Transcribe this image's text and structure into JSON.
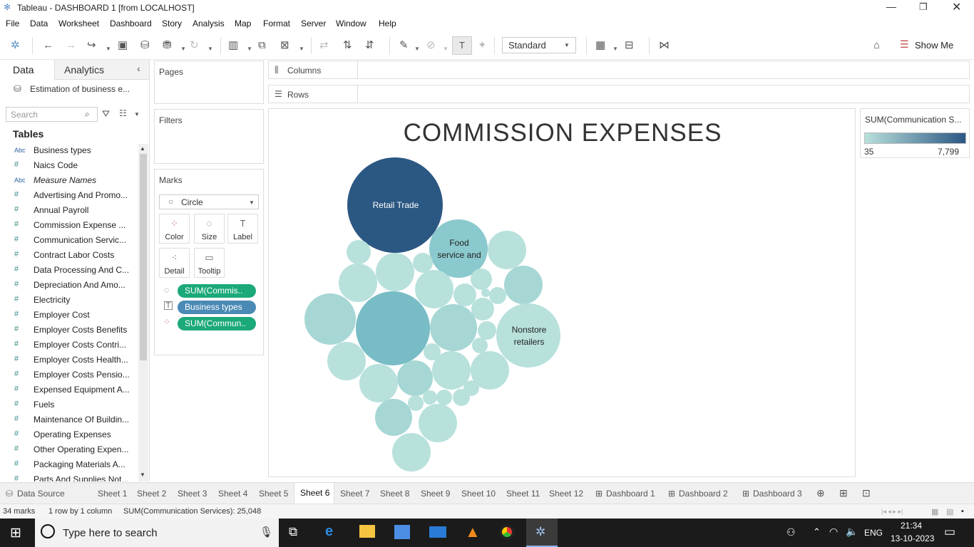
{
  "window": {
    "title": "Tableau - DASHBOARD 1 [from LOCALHOST]"
  },
  "menu": [
    "File",
    "Data",
    "Worksheet",
    "Dashboard",
    "Story",
    "Analysis",
    "Map",
    "Format",
    "Server",
    "Window",
    "Help"
  ],
  "toolbar": {
    "fit": "Standard",
    "show_me": "Show Me"
  },
  "sidepanel": {
    "tab_data": "Data",
    "tab_analytics": "Analytics",
    "datasource": "Estimation of business e...",
    "search_placeholder": "Search",
    "tables_heading": "Tables",
    "fields": [
      {
        "icon": "Abc",
        "name": "Business types"
      },
      {
        "icon": "#",
        "name": "Naics Code"
      },
      {
        "icon": "Abc",
        "name": "Measure Names"
      },
      {
        "icon": "#",
        "name": "Advertising And Promo..."
      },
      {
        "icon": "#",
        "name": "Annual Payroll"
      },
      {
        "icon": "#",
        "name": "Commission Expense ..."
      },
      {
        "icon": "#",
        "name": "Communication Servic..."
      },
      {
        "icon": "#",
        "name": "Contract Labor Costs"
      },
      {
        "icon": "#",
        "name": "Data Processing And C..."
      },
      {
        "icon": "#",
        "name": "Depreciation And Amo..."
      },
      {
        "icon": "#",
        "name": "Electricity"
      },
      {
        "icon": "#",
        "name": "Employer Cost"
      },
      {
        "icon": "#",
        "name": "Employer Costs Benefits"
      },
      {
        "icon": "#",
        "name": "Employer Costs Contri..."
      },
      {
        "icon": "#",
        "name": "Employer Costs Health..."
      },
      {
        "icon": "#",
        "name": "Employer Costs Pensio..."
      },
      {
        "icon": "#",
        "name": "Expensed Equipment A..."
      },
      {
        "icon": "#",
        "name": "Fuels"
      },
      {
        "icon": "#",
        "name": "Maintenance Of Buildin..."
      },
      {
        "icon": "#",
        "name": "Operating Expenses"
      },
      {
        "icon": "#",
        "name": "Other Operating Expen..."
      },
      {
        "icon": "#",
        "name": "Packaging Materials A..."
      },
      {
        "icon": "#",
        "name": "Parts And Supplies Not..."
      }
    ]
  },
  "cards": {
    "pages": "Pages",
    "filters": "Filters",
    "marks": "Marks",
    "mark_type": "Circle",
    "mark_buttons": [
      "Color",
      "Size",
      "Label",
      "Detail",
      "Tooltip"
    ],
    "pills": [
      "SUM(Commis..",
      "Business types",
      "SUM(Commun.."
    ]
  },
  "shelves": {
    "columns": "Columns",
    "rows": "Rows"
  },
  "viz": {
    "title": "COMMISSION EXPENSES",
    "labels": {
      "retail": "Retail Trade",
      "food1": "Food",
      "food2": "service and",
      "non1": "Nonstore",
      "non2": "retailers"
    }
  },
  "legend": {
    "title": "SUM(Communication S...",
    "min": "35",
    "max": "7,799",
    "color_min": "#b8e0dc",
    "color_max": "#2b5783"
  },
  "sheets": [
    "Data Source",
    "Sheet 1",
    "Sheet 2",
    "Sheet 3",
    "Sheet 4",
    "Sheet 5",
    "Sheet 6",
    "Sheet 7",
    "Sheet 8",
    "Sheet 9",
    "Sheet 10",
    "Sheet 11",
    "Sheet 12",
    "Dashboard 1",
    "Dashboard 2",
    "Dashboard 3"
  ],
  "status": {
    "marks": "34 marks",
    "rows": "1 row by 1 column",
    "sum": "SUM(Communication Services): 25,048"
  },
  "taskbar": {
    "search": "Type here to search",
    "lang": "ENG",
    "time": "21:34",
    "date": "13-10-2023"
  }
}
